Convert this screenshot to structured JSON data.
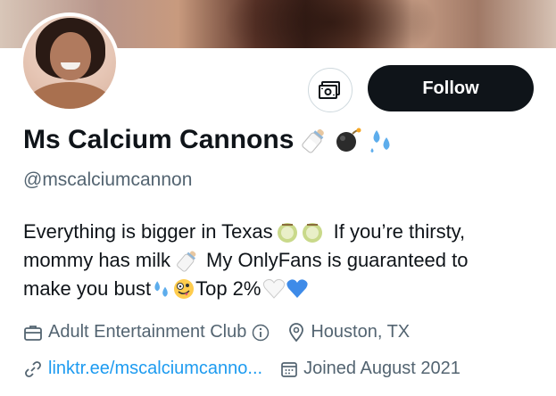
{
  "profile": {
    "name": "Ms Calcium Cannons",
    "handle": "@mscalciumcannon",
    "follow_label": "Follow",
    "name_emojis": [
      "baby-bottle-emoji",
      "bomb-emoji",
      "sweat-droplets-emoji"
    ]
  },
  "bio": {
    "line1_a": "Everything is bigger in Texas",
    "line1_b": "If you’re thirsty,",
    "line2_a": "mommy has milk",
    "line2_b": "My OnlyFans is guaranteed to",
    "line3_a": "make you bust",
    "line3_b": "Top 2%"
  },
  "meta": {
    "category": "Adult Entertainment Club",
    "location": "Houston, TX",
    "link": "linktr.ee/mscalciumcanno...",
    "joined": "Joined August 2021"
  },
  "colors": {
    "text": "#0f1419",
    "secondary": "#536471",
    "link": "#1d9bf0",
    "follow_bg": "#0f1419"
  }
}
